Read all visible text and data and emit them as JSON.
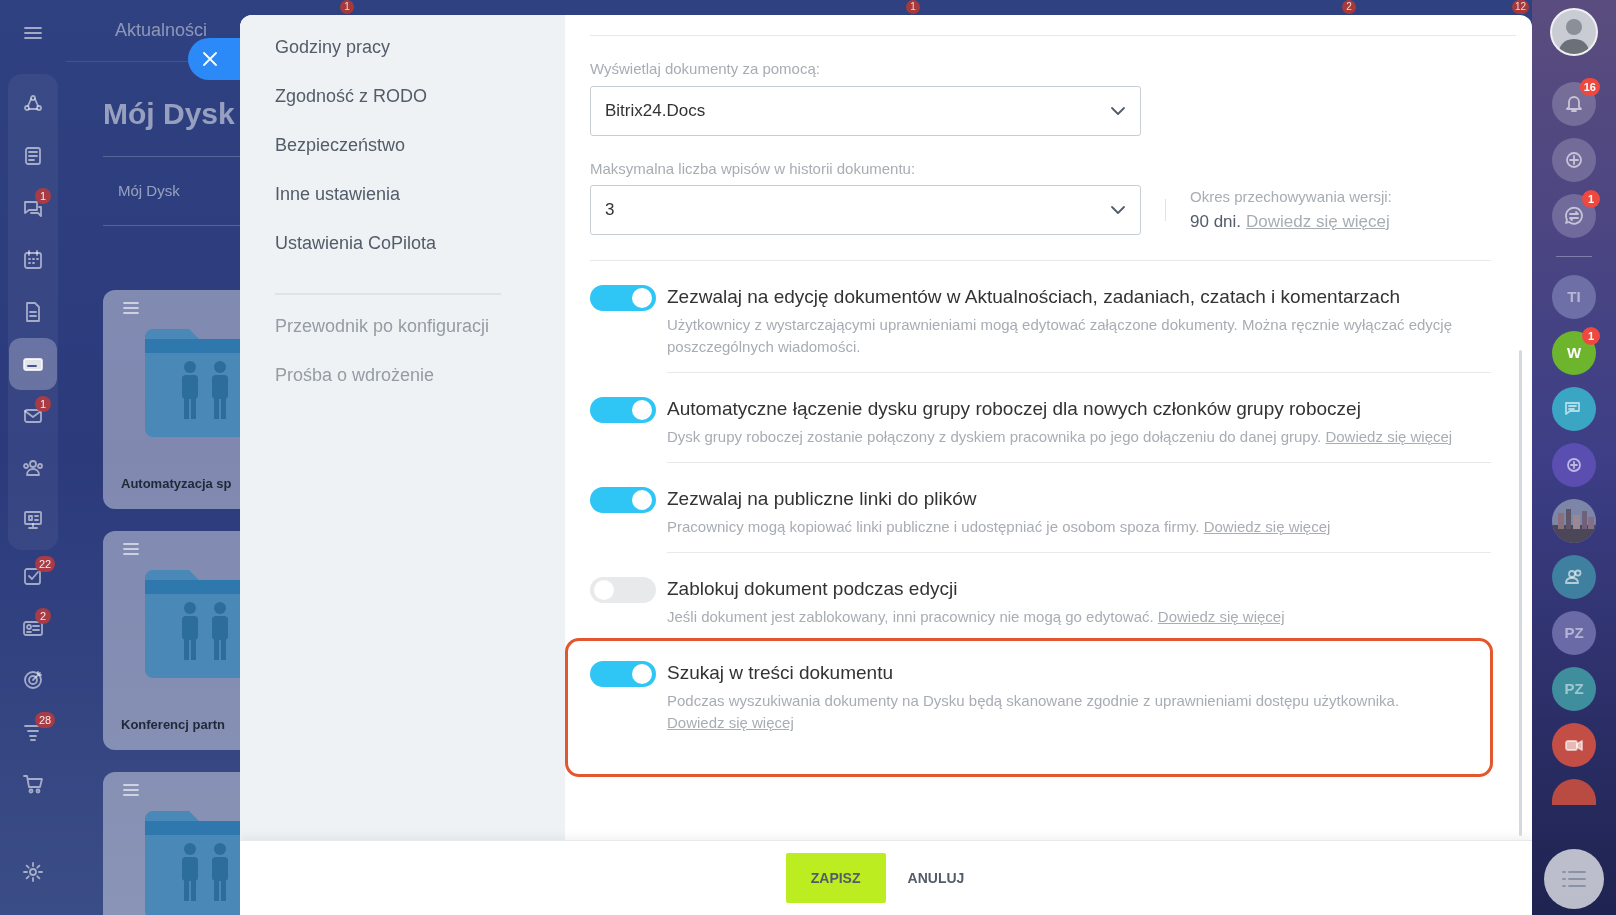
{
  "top_badges": [
    "1",
    "1",
    "2",
    "12"
  ],
  "left_nav": [
    {
      "selected": false
    },
    {
      "selected": false
    },
    {
      "selected": false,
      "badge": "1"
    },
    {
      "selected": false
    },
    {
      "selected": false
    },
    {
      "selected": true
    },
    {
      "selected": false,
      "badge": "1"
    },
    {
      "selected": false
    },
    {
      "selected": false
    },
    {
      "selected": false,
      "badge": "22"
    },
    {
      "selected": false,
      "badge": "2"
    },
    {
      "selected": false
    },
    {
      "selected": false,
      "badge": "28"
    },
    {
      "selected": false
    },
    {
      "selected": false
    }
  ],
  "background_page": {
    "breadcrumb": "Aktualności",
    "title": "Mój Dysk",
    "tab": "Mój Dysk",
    "cards": [
      {
        "kind": "folder",
        "name": "Automatyzacja sp"
      },
      {
        "kind": "folder",
        "name": "Konferencj partn"
      },
      {
        "kind": "folder"
      }
    ]
  },
  "settings_menu": [
    {
      "label": "Godziny pracy",
      "kind": "section"
    },
    {
      "label": "Zgodność z RODO",
      "kind": "section"
    },
    {
      "label": "Bezpieczeństwo",
      "kind": "section"
    },
    {
      "label": "Inne ustawienia",
      "kind": "section"
    },
    {
      "label": "Ustawienia CoPilota",
      "kind": "section"
    },
    {
      "label": "Przewodnik po konfiguracji",
      "kind": "help"
    },
    {
      "label": "Prośba o wdrożenie",
      "kind": "help"
    }
  ],
  "selects": [
    {
      "label": "Wyświetlaj dokumenty za pomocą:",
      "value": "Bitrix24.Docs"
    },
    {
      "label": "Maksymalna liczba wpisów w historii dokumentu:",
      "value": "3"
    }
  ],
  "retention": {
    "label": "Okres przechowywania wersji:",
    "value": "90 dni.",
    "link": "Dowiedz się więcej"
  },
  "toggles": [
    {
      "title": "Zezwalaj na edycję dokumentów w Aktualnościach, zadaniach, czatach i komentarzach",
      "description": "Użytkownicy z wystarczającymi uprawnieniami mogą edytować załączone dokumenty. Można ręcznie wyłączać edycję poszczególnych wiadomości.",
      "on": true,
      "highlighted": false
    },
    {
      "title": "Automatyczne łączenie dysku grupy roboczej dla nowych członków grupy roboczej",
      "description": "Dysk grupy roboczej zostanie połączony z dyskiem pracownika po jego dołączeniu do danej grupy.",
      "link": "Dowiedz się więcej",
      "on": true,
      "highlighted": false
    },
    {
      "title": "Zezwalaj na publiczne linki do plików",
      "description": "Pracownicy mogą kopiować linki publiczne i udostępniać je osobom spoza firmy.",
      "link": "Dowiedz się więcej",
      "on": true,
      "highlighted": false
    },
    {
      "title": "Zablokuj dokument podczas edycji",
      "description": "Jeśli dokument jest zablokowany, inni pracownicy nie mogą go edytować.",
      "link": "Dowiedz się więcej",
      "on": false,
      "highlighted": false
    },
    {
      "title": "Szukaj w treści dokumentu",
      "description": "Podczas wyszukiwania dokumenty na Dysku będą skanowane zgodnie z uprawnieniami dostępu użytkownika.",
      "link": "Dowiedz się więcej",
      "on": true,
      "highlighted": true
    }
  ],
  "footer": {
    "save": "ZAPISZ",
    "cancel": "ANULUJ"
  },
  "right_rail": [
    {
      "kind": "avatar"
    },
    {
      "kind": "icon",
      "badge": "16"
    },
    {
      "kind": "icon"
    },
    {
      "kind": "icon",
      "badge": "1"
    },
    {
      "kind": "divider"
    },
    {
      "kind": "letters",
      "text": "TI",
      "color": "#6e6fa6"
    },
    {
      "kind": "letters",
      "text": "W",
      "color": "#6cb52d",
      "badge": "1"
    },
    {
      "kind": "icon",
      "color": "#3aa6c4"
    },
    {
      "kind": "icon",
      "color": "#5a4fb0"
    },
    {
      "kind": "picture"
    },
    {
      "kind": "icon",
      "color": "#3f7f9f"
    },
    {
      "kind": "letters",
      "text": "PZ",
      "color": "#6a6aa6"
    },
    {
      "kind": "letters",
      "text": "PZ",
      "color": "#3e8e9e"
    },
    {
      "kind": "icon",
      "color": "#c24e45"
    },
    {
      "kind": "partial",
      "color": "#b94b42"
    }
  ]
}
